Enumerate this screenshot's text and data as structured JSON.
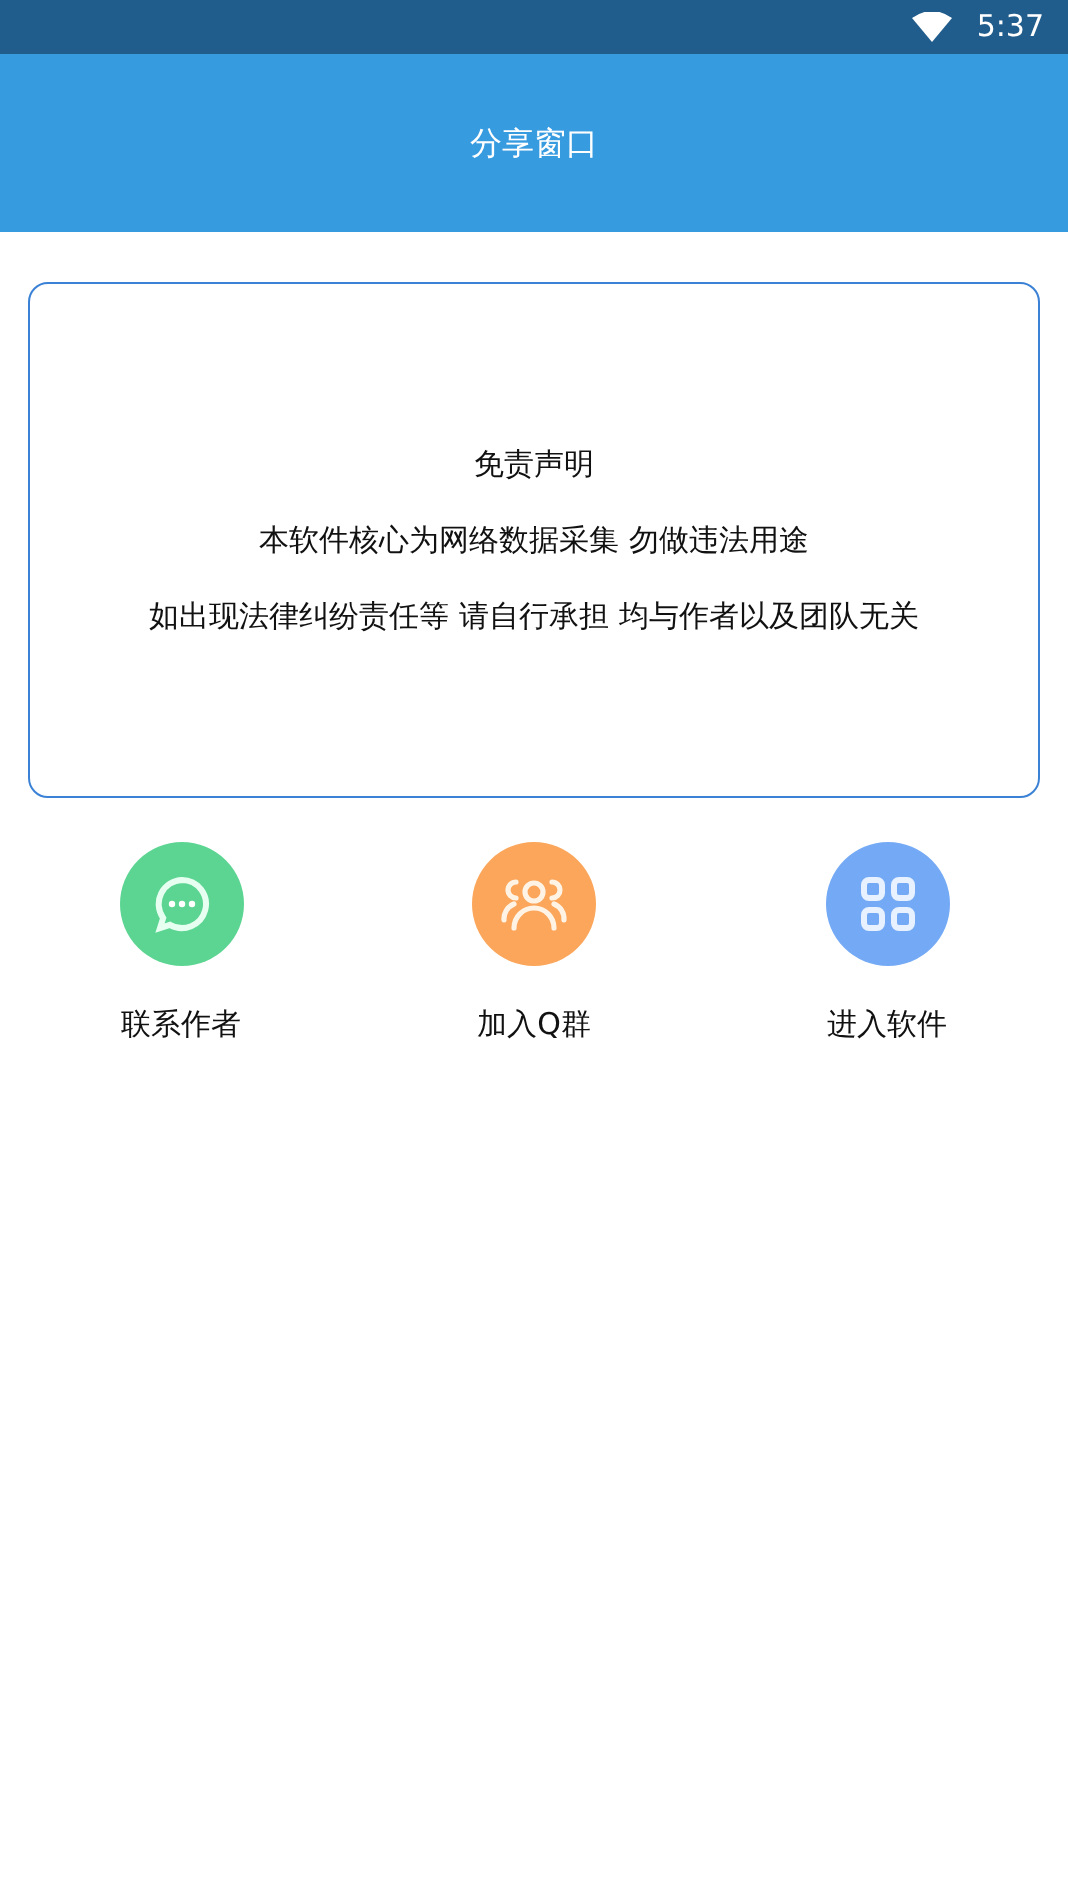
{
  "status_bar": {
    "time": "5:37"
  },
  "header": {
    "title": "分享窗口"
  },
  "notice": {
    "lines": [
      "免责声明",
      "本软件核心为网络数据采集 勿做违法用途",
      "如出现法律纠纷责任等 请自行承担 均与作者以及团队无关"
    ]
  },
  "actions": [
    {
      "kind": "chat",
      "label": "联系作者",
      "color": "#5cd592"
    },
    {
      "kind": "group",
      "label": "加入Q群",
      "color": "#fba65a"
    },
    {
      "kind": "apps",
      "label": "进入软件",
      "color": "#74aaf5"
    }
  ]
}
